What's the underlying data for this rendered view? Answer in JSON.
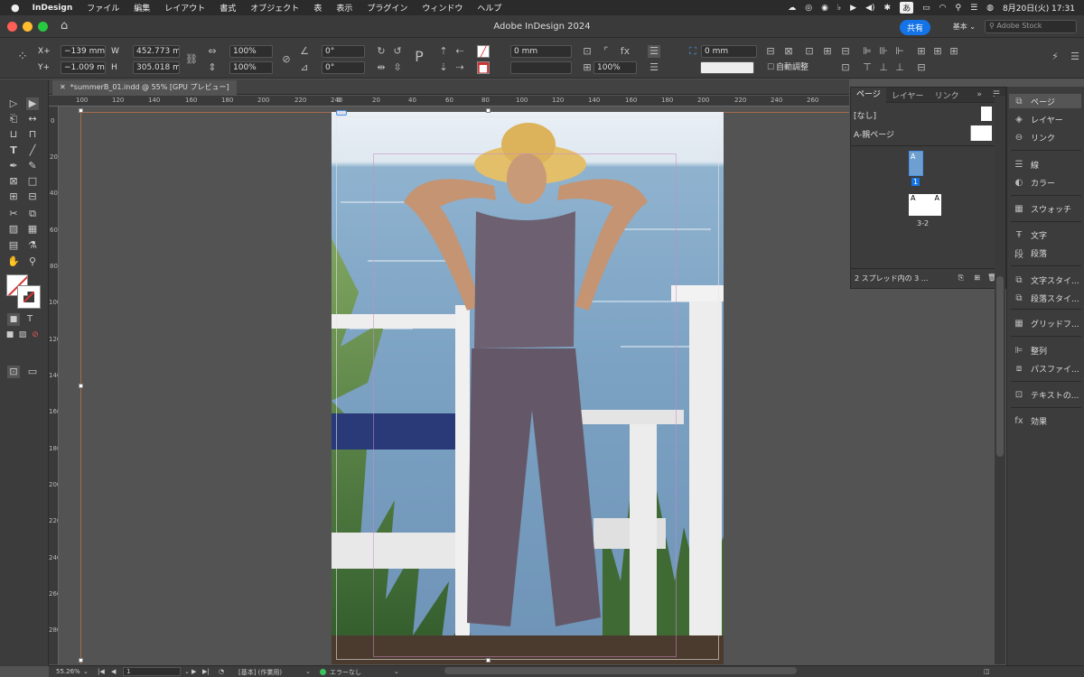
{
  "menubar": {
    "app_name": "InDesign",
    "menus": [
      "ファイル",
      "編集",
      "レイアウト",
      "書式",
      "オブジェクト",
      "表",
      "表示",
      "プラグイン",
      "ウィンドウ",
      "ヘルプ"
    ],
    "input_indicator": "あ",
    "datetime": "8月20日(火) 17:31"
  },
  "window": {
    "title": "Adobe InDesign 2024",
    "share_label": "共有",
    "workspace_label": "基本 ⌄",
    "stock_placeholder": "Adobe Stock",
    "traffic_colors": [
      "#ff5f57",
      "#febc2e",
      "#28c840"
    ]
  },
  "control": {
    "x_label": "X+",
    "x_value": "−139 mm",
    "y_label": "Y+",
    "y_value": "−1.009 mm",
    "w_label": "W",
    "w_value": "452.773 m",
    "h_label": "H",
    "h_value": "305.018 m",
    "scale_x": "100%",
    "scale_y": "100%",
    "rotate": "0°",
    "shear": "0°",
    "stroke_weight": "0 mm",
    "effect_opacity": "100%",
    "fit_value": "0 mm",
    "auto_fit_label": "自動調整"
  },
  "document": {
    "tab_label": "*summerB_01.indd @ 55% [GPU プレビュー]"
  },
  "rulers": {
    "h_ticks": [
      "100",
      "120",
      "140",
      "160",
      "180",
      "200",
      "220",
      "240",
      "260",
      "280",
      "300",
      "0",
      "20",
      "40",
      "60",
      "80",
      "100",
      "120",
      "140",
      "160",
      "180",
      "200",
      "220",
      "240",
      "260",
      "280",
      "300"
    ],
    "v_ticks": [
      "0",
      "20",
      "40",
      "60",
      "80",
      "100",
      "120",
      "140",
      "160",
      "180",
      "200",
      "220",
      "240",
      "260",
      "280"
    ]
  },
  "pages_panel": {
    "tabs": [
      "ページ",
      "レイヤー",
      "リンク"
    ],
    "none_label": "[なし]",
    "parent_label": "A-親ページ",
    "page_number": "1",
    "spread_label": "3-2",
    "footer": "2 スプレッド内の 3 ..."
  },
  "dock": {
    "items": [
      "ページ",
      "レイヤー",
      "リンク",
      "線",
      "カラー",
      "スウォッチ",
      "文字",
      "段落",
      "文字スタイ...",
      "段落スタイ...",
      "グリッドフ...",
      "整列",
      "パスファイ...",
      "テキストの...",
      "効果"
    ]
  },
  "status": {
    "zoom": "55.26%",
    "page": "1",
    "style": "[基本] (作業用)",
    "preflight": "エラーなし",
    "preflight_color": "#3ac35a"
  }
}
